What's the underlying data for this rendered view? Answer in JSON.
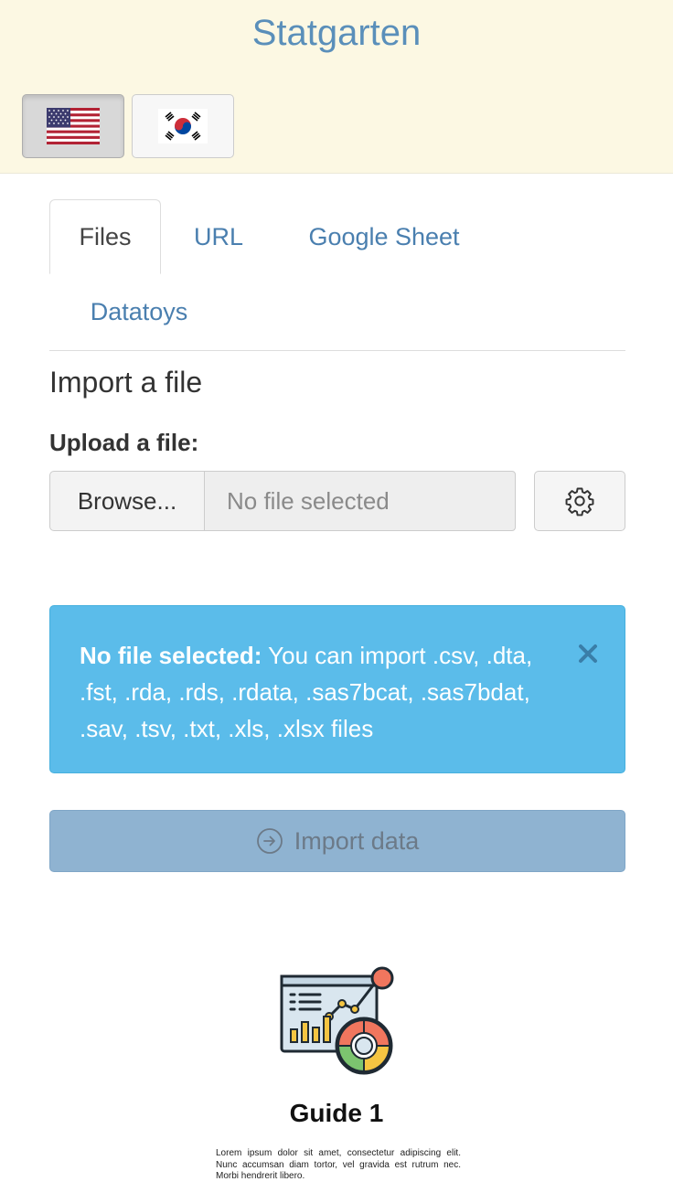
{
  "header": {
    "brand": "Statgarten",
    "languages": [
      {
        "code": "en",
        "icon": "us-flag-icon",
        "active": true
      },
      {
        "code": "ko",
        "icon": "korea-flag-icon",
        "active": false
      }
    ],
    "colors": {
      "background": "#fcf8e3",
      "brand": "#5a8fba"
    }
  },
  "tabs": [
    {
      "label": "Files",
      "active": true
    },
    {
      "label": "URL",
      "active": false
    },
    {
      "label": "Google Sheet",
      "active": false
    },
    {
      "label": "Datatoys",
      "active": false
    }
  ],
  "main": {
    "title": "Import a file",
    "upload_label": "Upload a file:",
    "browse_label": "Browse...",
    "file_placeholder": "No file selected",
    "settings_icon": "gear-icon"
  },
  "alert": {
    "strong": "No file selected:",
    "message": " You can import .csv, .dta, .fst, .rda, .rds, .rdata, .sas7bcat, .sas7bdat, .sav, .tsv, .txt, .xls, .xlsx files",
    "close_icon": "close-icon",
    "color": "#5bbcea"
  },
  "import_button": {
    "label": "Import data",
    "icon": "arrow-circle-right-icon",
    "disabled": true,
    "color": "#8fb3d1"
  },
  "guide": {
    "title": "Guide 1",
    "body": "Lorem ipsum dolor sit amet, consectetur adipiscing elit. Nunc accumsan diam tortor, vel gravida est rutrum nec. Morbi hendrerit libero.",
    "image_icon": "dashboard-analytics-icon"
  }
}
